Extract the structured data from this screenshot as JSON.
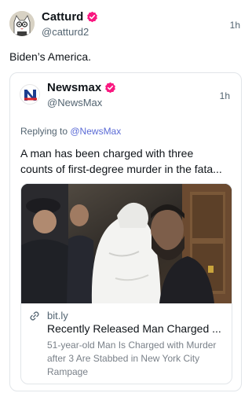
{
  "post": {
    "author_name": "Catturd",
    "author_handle": "@catturd2",
    "timestamp": "1h",
    "text": "Biden’s America.",
    "avatar_icon": "cat-avatar",
    "verified_icon": "verified-badge-icon"
  },
  "quoted": {
    "author_name": "Newsmax",
    "author_handle": "@NewsMax",
    "timestamp": "1h",
    "avatar_icon": "newsmax-logo",
    "reply_prefix": "Replying to ",
    "reply_mention": "@NewsMax",
    "text_line1": "A man has been charged with three",
    "text_line2": "counts of first-degree murder in the fata...",
    "link_card": {
      "link_icon": "link-icon",
      "domain": "bit.ly",
      "title": "Recently Released Man Charged ...",
      "description": "51-year-old Man Is Charged with Murder after 3 Are Stabbed in New York City Rampage"
    }
  },
  "colors": {
    "verified": "#f91880",
    "mention": "#5b6bd6",
    "secondary_text": "#536471",
    "border": "#e1e5e9"
  }
}
